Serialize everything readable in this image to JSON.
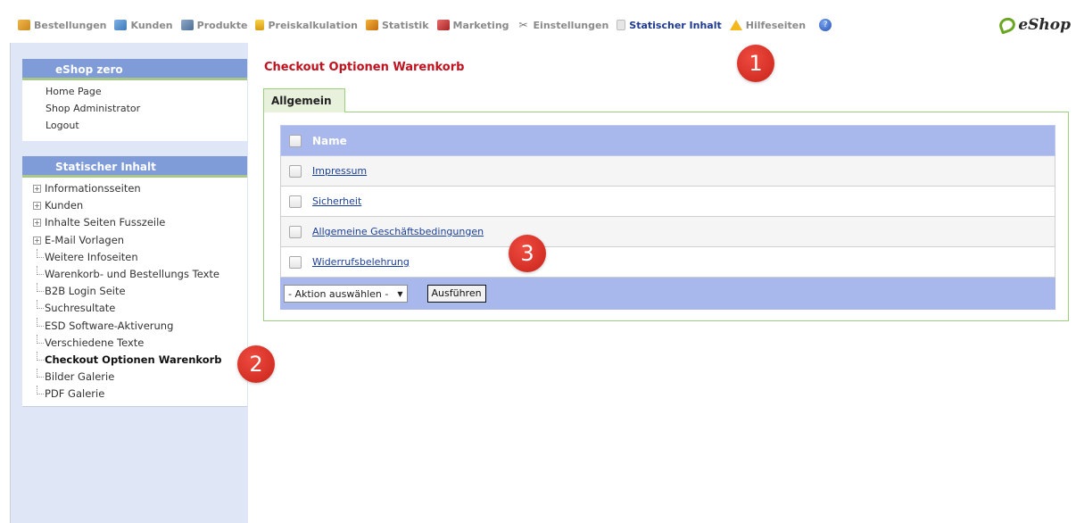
{
  "nav": {
    "items": [
      {
        "label": "Bestellungen",
        "icon": "orders-icon"
      },
      {
        "label": "Kunden",
        "icon": "customers-icon"
      },
      {
        "label": "Produkte",
        "icon": "products-icon"
      },
      {
        "label": "Preiskalkulation",
        "icon": "price-icon"
      },
      {
        "label": "Statistik",
        "icon": "statistics-icon"
      },
      {
        "label": "Marketing",
        "icon": "marketing-icon"
      },
      {
        "label": "Einstellungen",
        "icon": "settings-icon"
      },
      {
        "label": "Statischer Inhalt",
        "icon": "static-content-icon",
        "active": true
      },
      {
        "label": "Hilfeseiten",
        "icon": "help-icon"
      }
    ],
    "logo_text": "eShop"
  },
  "sidebar": {
    "shop_title": "eShop zero",
    "links": [
      "Home Page",
      "Shop Administrator",
      "Logout"
    ],
    "section_title": "Statischer Inhalt",
    "tree": [
      {
        "label": "Informationsseiten",
        "expandable": true
      },
      {
        "label": "Kunden",
        "expandable": true
      },
      {
        "label": "Inhalte Seiten Fusszeile",
        "expandable": true
      },
      {
        "label": "E-Mail Vorlagen",
        "expandable": true
      },
      {
        "label": "Weitere Infoseiten"
      },
      {
        "label": "Warenkorb- und Bestellungs Texte"
      },
      {
        "label": "B2B Login Seite"
      },
      {
        "label": "Suchresultate"
      },
      {
        "label": "ESD Software-Aktiverung"
      },
      {
        "label": "Verschiedene Texte"
      },
      {
        "label": "Checkout Optionen Warenkorb",
        "selected": true
      },
      {
        "label": "Bilder Galerie"
      },
      {
        "label": "PDF Galerie"
      }
    ]
  },
  "main": {
    "title": "Checkout Optionen Warenkorb",
    "tab_label": "Allgemein",
    "table": {
      "header": "Name",
      "rows": [
        "Impressum",
        "Sicherheit",
        "Allgemeine Geschäftsbedingungen",
        "Widerrufsbelehrung"
      ]
    },
    "action_select": "- Aktion auswählen -",
    "execute_button": "Ausführen"
  },
  "markers": [
    "1",
    "2",
    "3"
  ],
  "colors": {
    "title_red": "#c1121f",
    "header_blue": "#a8b7ec",
    "sidebar_head": "#7f9bd8",
    "link_blue": "#1a3f9c",
    "active_nav": "#1f3c8f",
    "tab_green": "#9ccf7b",
    "marker_red": "#d9322a"
  }
}
